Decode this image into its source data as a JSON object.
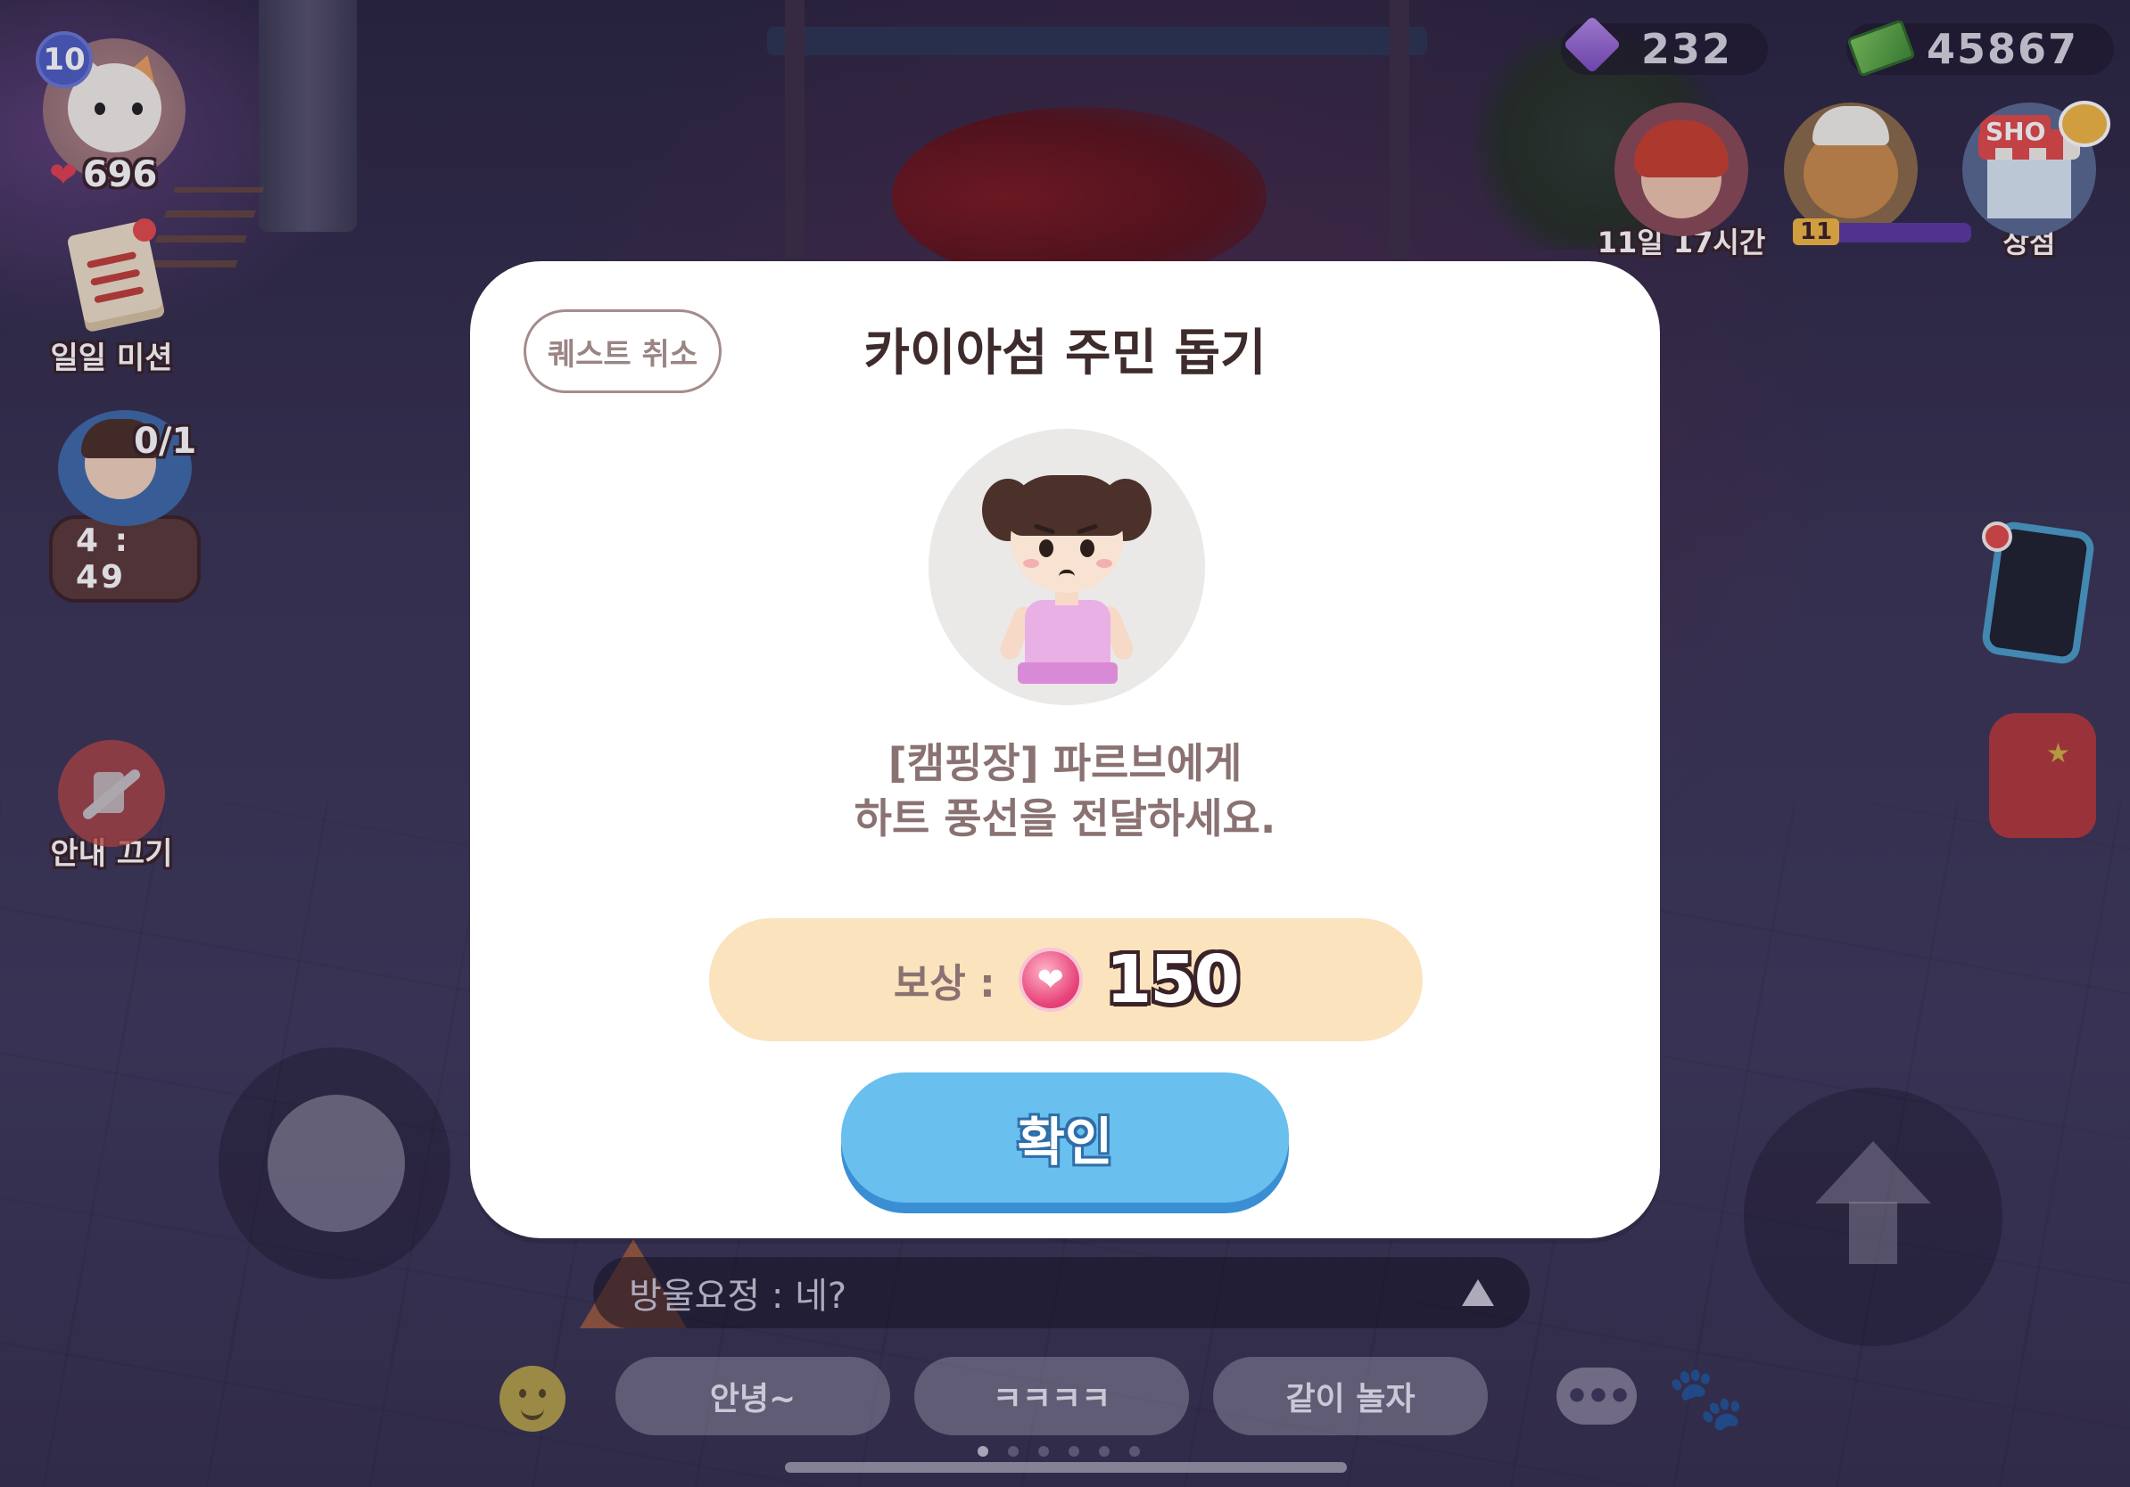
{
  "player": {
    "level": "10",
    "hearts": "696"
  },
  "left_menu": {
    "daily_mission_label": "일일 미션",
    "npc_quest_progress": "0/1",
    "npc_quest_timer": "4 : 49",
    "guide_off_label": "안내 끄기"
  },
  "currency": {
    "gems": "232",
    "cash": "45867"
  },
  "top_right": {
    "event_timer": "11일 17시간",
    "bear_level": "11",
    "shop_sign": "SHO",
    "shop_label": "상점"
  },
  "modal": {
    "cancel_label": "퀘스트 취소",
    "title": "카이아섬 주민 돕기",
    "description_line1": "[캠핑장] 파르브에게",
    "description_line2": "하트 풍선을 전달하세요.",
    "reward_label": "보상 :",
    "reward_value": "150",
    "confirm_label": "확인"
  },
  "chat": {
    "last_message": "방울요정 : 네?",
    "quick_replies": [
      "안녕~",
      "ㅋㅋㅋㅋ",
      "같이 놀자"
    ],
    "chat_icon_text": "•••"
  },
  "icons": {
    "heart": "heart-icon",
    "gem": "gem-icon",
    "cash": "cash-icon",
    "reward": "heart-coin-icon",
    "paw": "paw-icon"
  },
  "colors": {
    "confirm_button": "#69bfee",
    "reward_bar": "#fbe3be",
    "modal_bg": "#ffffff",
    "title_text": "#3e2b2b"
  }
}
